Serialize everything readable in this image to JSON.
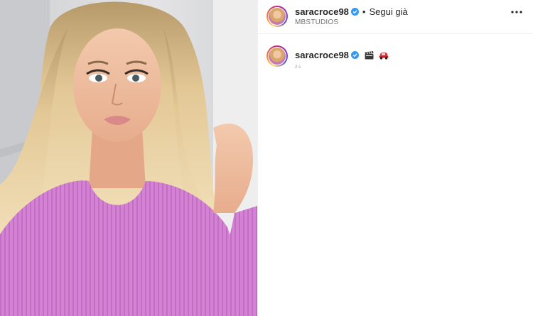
{
  "post": {
    "author": {
      "username": "saracroce98",
      "verified": true,
      "follow_state": "Segui già",
      "separator": "•",
      "location": "MBSTUDIOS"
    },
    "caption": {
      "username": "saracroce98",
      "emojis": [
        "clapper-board-emoji",
        "car-emoji"
      ]
    },
    "comment_meta": "2 s"
  },
  "icons": {
    "verified": "verified-badge-icon",
    "more": "more-options-icon"
  },
  "colors": {
    "verified_blue": "#3897f0",
    "sweater_pink": "#d27ad0",
    "text": "#262626",
    "muted": "#737373"
  }
}
